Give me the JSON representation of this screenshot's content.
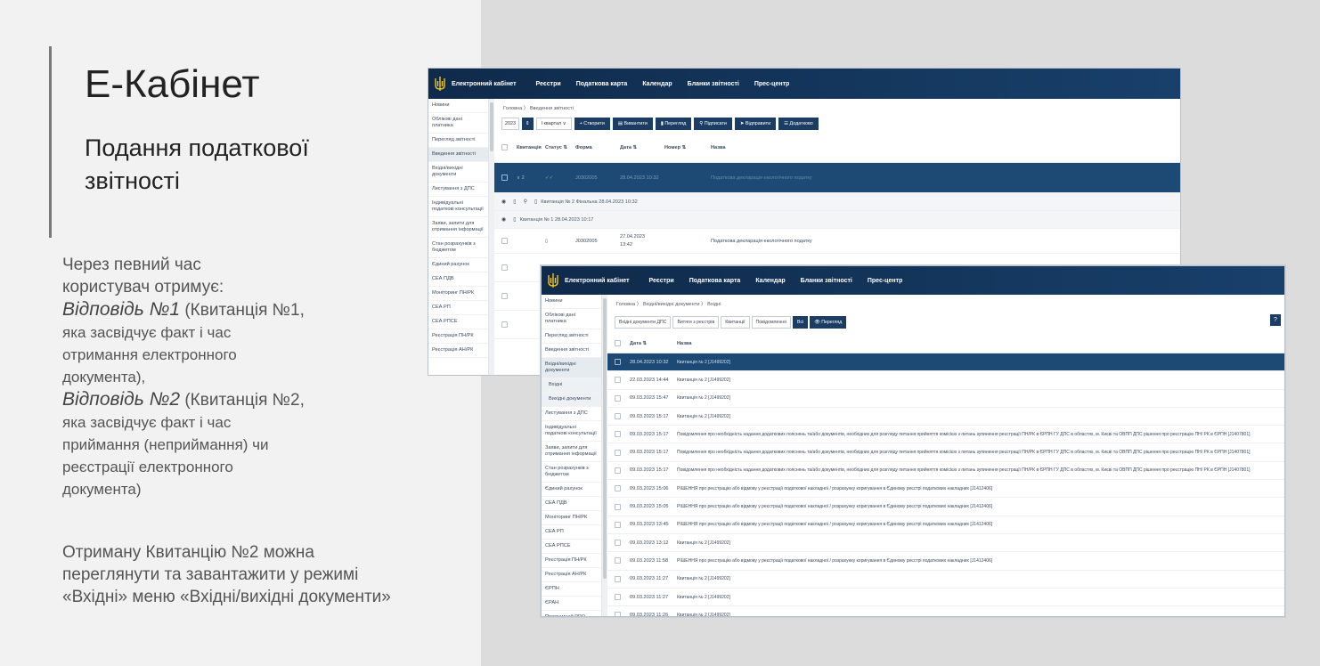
{
  "slide": {
    "title": "Е-Кабінет",
    "subtitle_line1": "Подання податкової",
    "subtitle_line2": "звітності",
    "p1_l1": "Через певний час",
    "p1_l2": "користувач отримує:",
    "ans1_em": "Відповідь №1",
    "ans1_rest": " (Квитанція №1,",
    "ans1_l2": "яка засвідчує факт і час",
    "ans1_l3": "отримання електронного",
    "ans1_l4": "документа),",
    "ans2_em": "Відповідь №2",
    "ans2_rest": " (Квитанція №2,",
    "ans2_l2": "яка засвідчує факт і час",
    "ans2_l3": "приймання (неприймання) чи",
    "ans2_l4": "реєстрації електронного",
    "ans2_l5": "документа)",
    "p3_l1": "Отриману Квитанцію №2 можна",
    "p3_l2": "переглянути та завантажити у режимі",
    "p3_l3": "«Вхідні» меню «Вхідні/вихідні документи»"
  },
  "app": {
    "brand": "Електронний кабінет",
    "nav": [
      "Реєстри",
      "Податкова карта",
      "Календар",
      "Бланки звітності",
      "Прес-центр"
    ]
  },
  "win1": {
    "sidebar": [
      "Новини",
      "Облікові дані платника",
      "Перегляд звітності",
      "Введення звітності",
      "Вхідні/вихідні документи",
      "Листування з ДПС",
      "Індивідуальні податкові консультації",
      "Заяви, запити для отримання інформації",
      "Стан розрахунків з бюджетом",
      "Єдиний рахунок",
      "СЕА ПДВ",
      "Моніторинг ПН/РК",
      "СЕА РП",
      "СЕА РПСЕ",
      "Реєстрація ПН/РК",
      "Реєстрація АН/РК"
    ],
    "breadcrumb": "Головна  〉 Введення звітності",
    "year": "2023",
    "quarter": "I квартал",
    "toolbar": [
      "+ Створити",
      "Вивантити",
      "Перегляд",
      "Підписати",
      "Відправити",
      "Додатково"
    ],
    "columns": {
      "receipt": "Квитанція",
      "status": "Статус ⇅",
      "form": "Форма",
      "date": "Дата ⇅",
      "number": "Номер ⇅",
      "name": "Назва"
    },
    "selected_row": {
      "receipt": "∨ 2",
      "status": "✓✓",
      "form": "J0302005",
      "date": "28.04.2023 10:32",
      "name": "Податкова декларація екологічного податку"
    },
    "receipt_rows": [
      "Квитанція № 2 Фінальна 28.04.2023 10:32",
      "Квитанція № 1 28.04.2023 10:17"
    ],
    "row": {
      "form": "J0302005",
      "date": "27.04.2023",
      "time": "13:42",
      "name": "Податкова декларація екологічного податку"
    }
  },
  "win2": {
    "sidebar": [
      "Новини",
      "Облікові дані платника",
      "Перегляд звітності",
      "Введення звітності",
      "Вхідні/вихідні документи",
      "Вхідні",
      "Вихідні документи",
      "Листування з ДПС",
      "Індивідуальні податкові консультації",
      "Заяви, запити для отримання інформації",
      "Стан розрахунків з бюджетом",
      "Єдиний рахунок",
      "СЕА ПДВ",
      "Моніторинг ПН/РК",
      "СЕА РП",
      "СЕА РПСЕ",
      "Реєстрація ПН/РК",
      "Реєстрація АН/РК",
      "ЄРПН",
      "ЄРАН",
      "Програмний РРО",
      "Дані РРО"
    ],
    "breadcrumb": "Головна  〉 Вхідні/вихідні документи  〉 Вхідні",
    "tabs": [
      "Вхідні документи ДПС",
      "Витяги з реєстрів",
      "Квитанції",
      "Повідомлення",
      "Всі",
      "👁 Перегляд"
    ],
    "help": "?",
    "columns": {
      "date": "Дата ⇅",
      "name": "Назва"
    },
    "rows": [
      {
        "date": "28.04.2023 10:32",
        "name": "Квитанція № 2 [J1499202]"
      },
      {
        "date": "22.03.2023 14:44",
        "name": "Квитанція № 2 [J1499202]"
      },
      {
        "date": "09.03.2023 15:47",
        "name": "Квитанція № 2 [J1499202]"
      },
      {
        "date": "09.03.2023 15:17",
        "name": "Квитанція № 2 [J1499202]"
      },
      {
        "date": "09.03.2023 15:17",
        "name": "Повідомлення про необхідність надання додаткових пояснень та/або документів, необхідних для розгляду питання прийняття комісією з питань зупинення реєстрації ПН/РК в ЄРПН ГУ ДПС в областях, м. Києві та ОВПП ДПС рішення про реєстрацію ПН/ РК в ЄРПН [J1407801]"
      },
      {
        "date": "09.03.2023 15:17",
        "name": "Повідомлення про необхідність надання додаткових пояснень та/або документів, необхідних для розгляду питання прийняття комісією з питань зупинення реєстрації ПН/РК в ЄРПН ГУ ДПС в областях, м. Києві та ОВПП ДПС рішення про реєстрацію ПН/ РК в ЄРПН [J1407801]"
      },
      {
        "date": "09.03.2023 15:17",
        "name": "Повідомлення про необхідність надання додаткових пояснень та/або документів, необхідних для розгляду питання прийняття комісією з питань зупинення реєстрації ПН/РК в ЄРПН ГУ ДПС в областях, м. Києві та ОВПП ДПС рішення про реєстрацію ПН/ РК в ЄРПН [J1407801]"
      },
      {
        "date": "09.03.2023 15:06",
        "name": "РІШЕННЯ про реєстрацію або відмову у реєстрації податкової накладної / розрахунку коригування в Єдиному реєстрі податкових накладних [J1412406]"
      },
      {
        "date": "09.03.2023 15:05",
        "name": "РІШЕННЯ про реєстрацію або відмову у реєстрації податкової накладної / розрахунку коригування в Єдиному реєстрі податкових накладних [J1412406]"
      },
      {
        "date": "09.03.2023 13:45",
        "name": "РІШЕННЯ про реєстрацію або відмову у реєстрації податкової накладної / розрахунку коригування в Єдиному реєстрі податкових накладних [J1412406]"
      },
      {
        "date": "09.03.2023 13:12",
        "name": "Квитанція № 2 [J1499202]"
      },
      {
        "date": "09.03.2023 11:58",
        "name": "РІШЕННЯ про реєстрацію або відмову у реєстрації податкової накладної / розрахунку коригування в Єдиному реєстрі податкових накладних [J1412406]"
      },
      {
        "date": "09.03.2023 11:27",
        "name": "Квитанція № 2 [J1499202]"
      },
      {
        "date": "09.03.2023 11:27",
        "name": "Квитанція № 2 [J1499202]"
      },
      {
        "date": "09.03.2023 11:26",
        "name": "Квитанція № 2 [J1499202]"
      }
    ]
  }
}
